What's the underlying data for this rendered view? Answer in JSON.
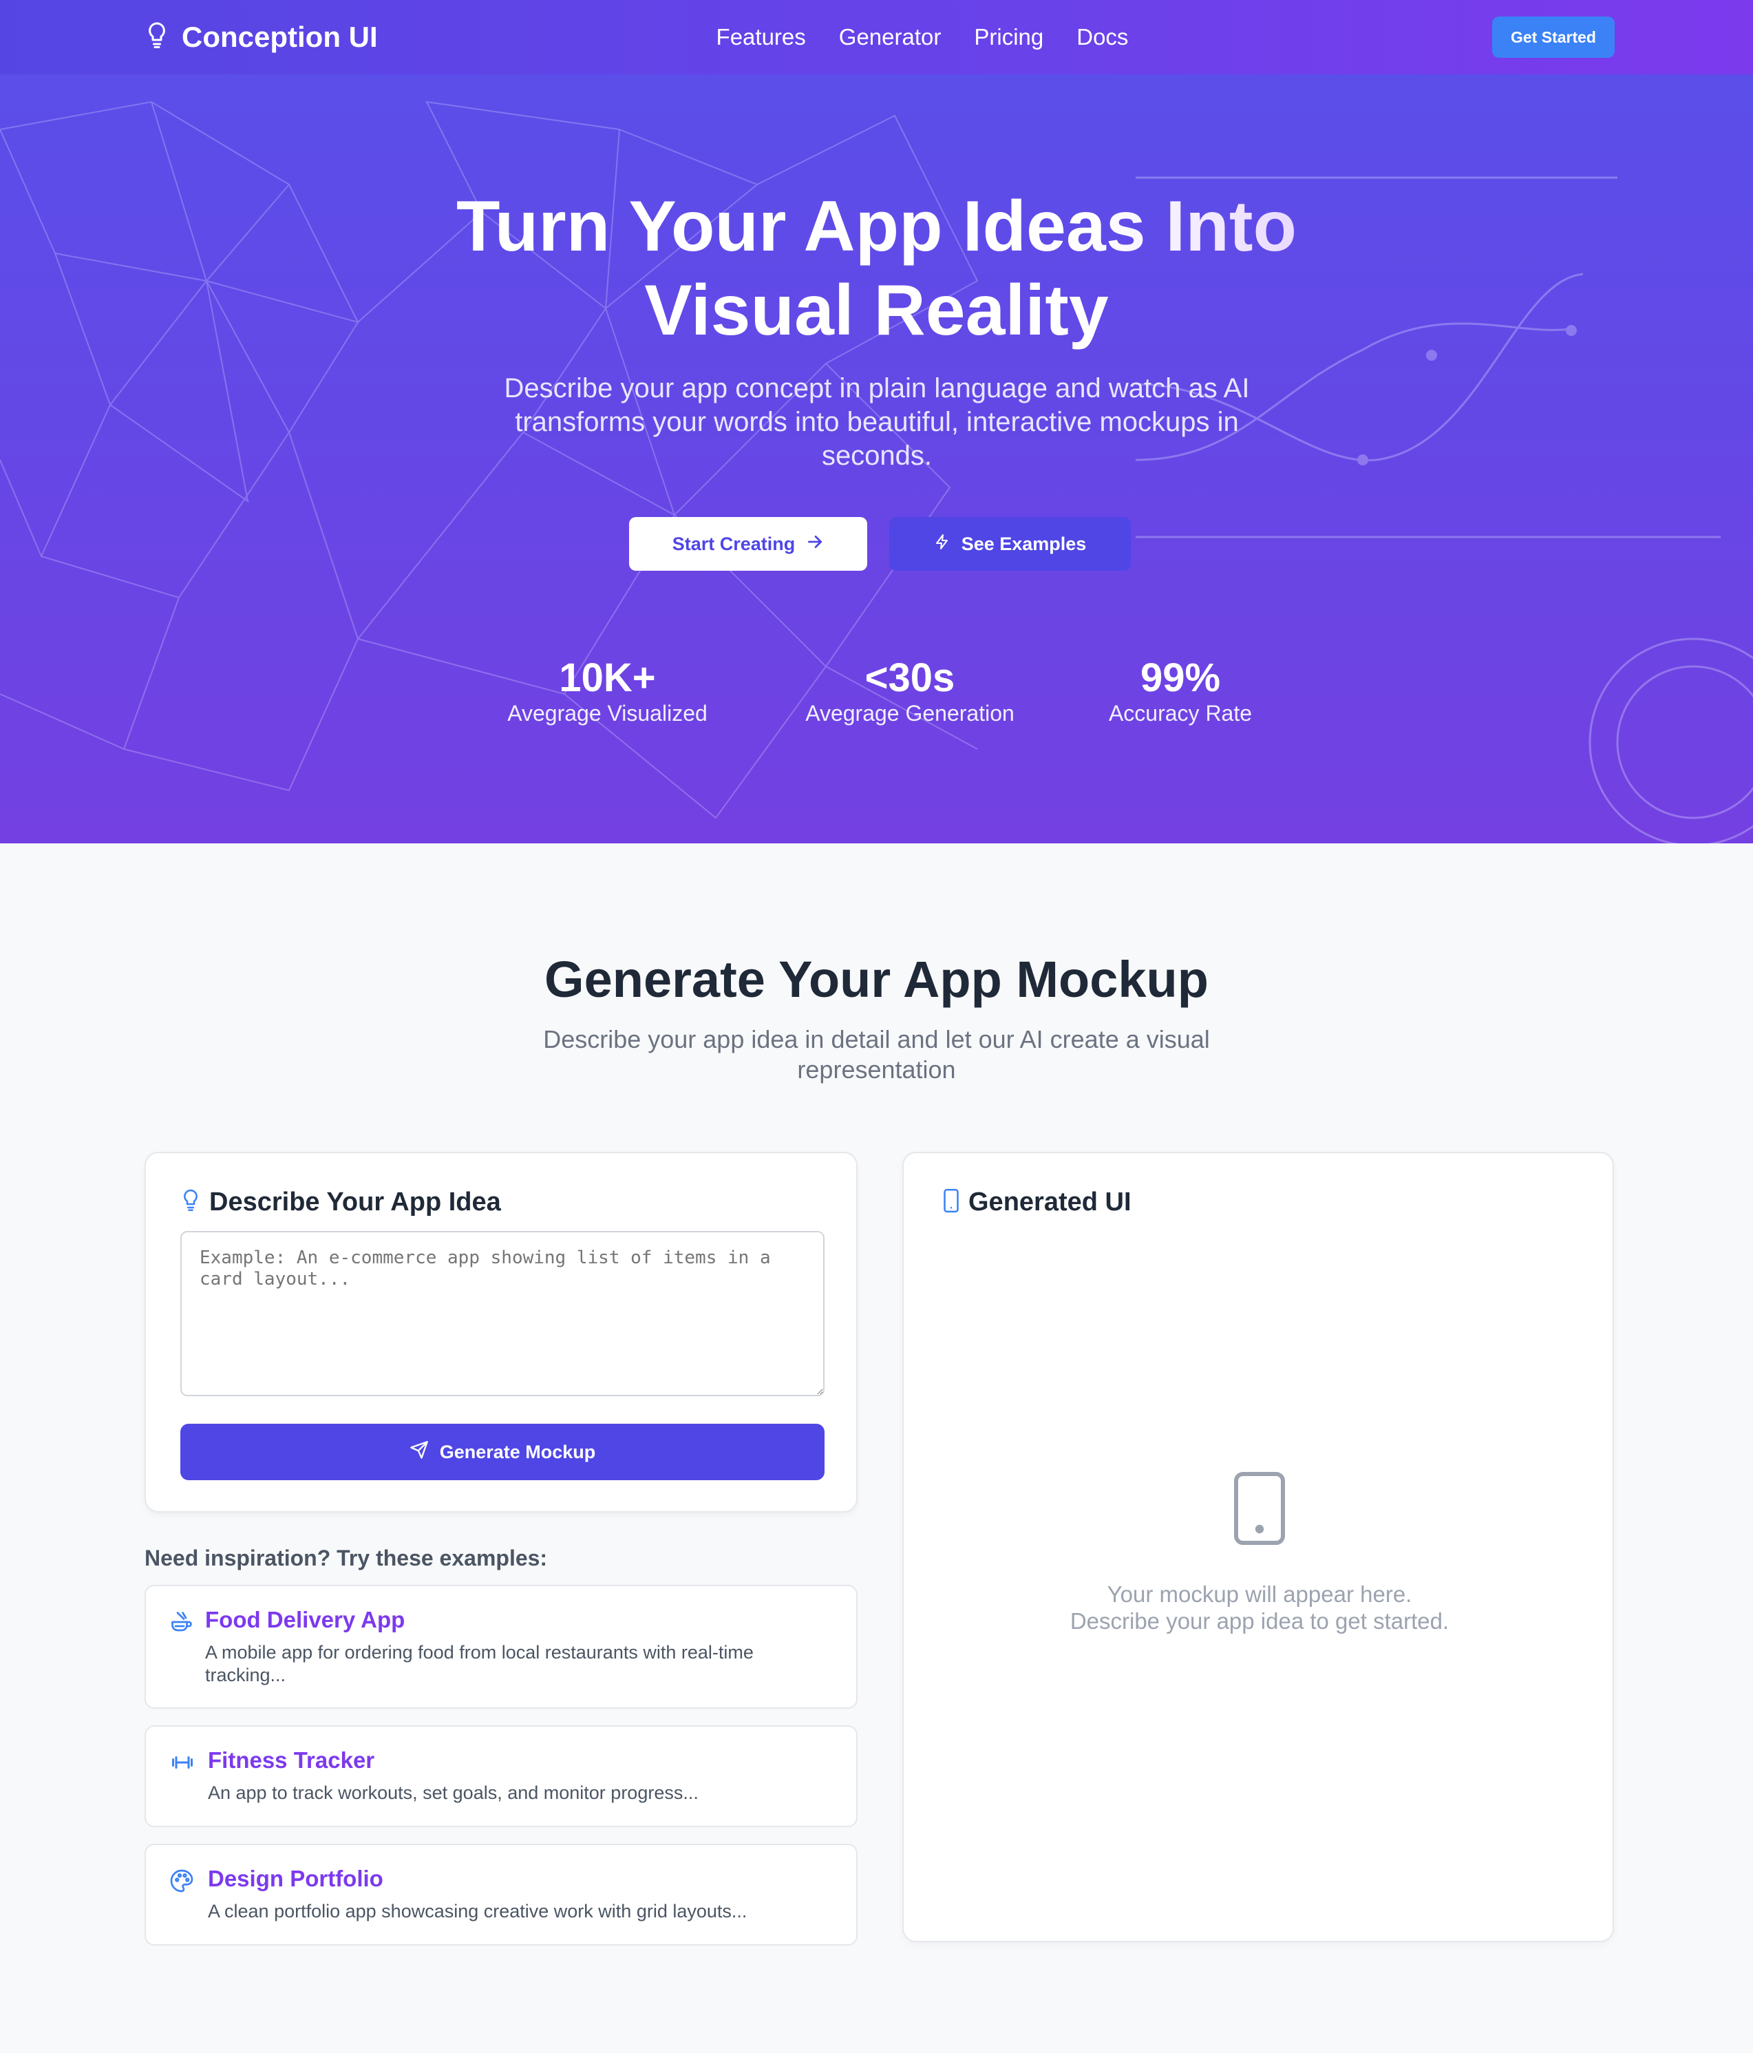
{
  "nav": {
    "brand": "Conception UI",
    "links": [
      "Features",
      "Generator",
      "Pricing",
      "Docs"
    ],
    "cta": "Get Started"
  },
  "hero": {
    "title_line1": "Turn Your App Ideas Into",
    "title_line2": "Visual Reality",
    "subtitle": "Describe your app concept in plain language and watch as AI transforms your words into beautiful, interactive mockups in seconds.",
    "primary_button": "Start Creating",
    "secondary_button": "See Examples",
    "stats": [
      {
        "value": "10K+",
        "label": "Avegrage Visualized"
      },
      {
        "value": "<30s",
        "label": "Avegrage Generation"
      },
      {
        "value": "99%",
        "label": "Accuracy Rate"
      }
    ]
  },
  "generator": {
    "title": "Generate Your App Mockup",
    "subtitle": "Describe your app idea in detail and let our AI create a visual representation",
    "describe_card": {
      "heading": "Describe Your App Idea",
      "textarea_value": "",
      "textarea_placeholder": "Example: An e-commerce app showing list of items in a card layout...",
      "button": "Generate Mockup"
    },
    "inspiration": {
      "heading": "Need inspiration? Try these examples:",
      "examples": [
        {
          "title": "Food Delivery App",
          "description": "A mobile app for ordering food from local restaurants with real-time tracking...",
          "icon": "food-icon"
        },
        {
          "title": "Fitness Tracker",
          "description": "An app to track workouts, set goals, and monitor progress...",
          "icon": "dumbbell-icon"
        },
        {
          "title": "Design Portfolio",
          "description": "A clean portfolio app showcasing creative work with grid layouts...",
          "icon": "palette-icon"
        }
      ]
    },
    "output_card": {
      "heading": "Generated UI",
      "empty_line1": "Your mockup will appear here.",
      "empty_line2": "Describe your app idea to get started."
    }
  },
  "colors": {
    "primary": "#4f46e5",
    "accent_purple": "#7c3aed",
    "cta_blue": "#3b82f6",
    "icon_blue": "#3b82f6"
  }
}
